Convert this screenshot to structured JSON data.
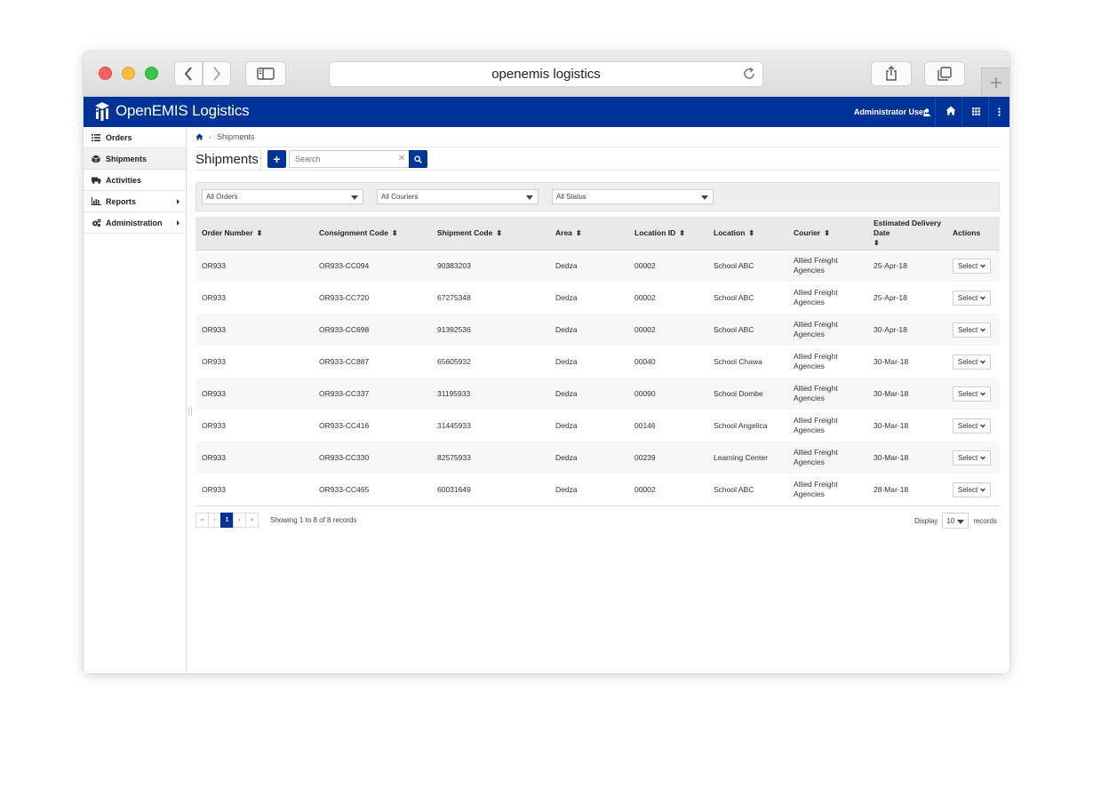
{
  "browser": {
    "url": "openemis logistics"
  },
  "app": {
    "title": "OpenEMIS Logistics",
    "user": "Administrator User",
    "accent": "#003399"
  },
  "sidebar": {
    "items": [
      {
        "label": "Orders",
        "icon": "list-icon",
        "active": false,
        "submenu": false
      },
      {
        "label": "Shipments",
        "icon": "box-icon",
        "active": true,
        "submenu": false
      },
      {
        "label": "Activities",
        "icon": "truck-icon",
        "active": false,
        "submenu": false
      },
      {
        "label": "Reports",
        "icon": "bar-chart-icon",
        "active": false,
        "submenu": true
      },
      {
        "label": "Administration",
        "icon": "cogs-icon",
        "active": false,
        "submenu": true
      }
    ]
  },
  "breadcrumb": {
    "current": "Shipments"
  },
  "page": {
    "title": "Shipments",
    "add_label": "+",
    "search_placeholder": "Search"
  },
  "filters": {
    "orders": "All Orders",
    "couriers": "All Couriers",
    "status": "All Status"
  },
  "table": {
    "headers": [
      "Order Number",
      "Consignment Code",
      "Shipment Code",
      "Area",
      "Location ID",
      "Location",
      "Courier",
      "Estimated Delivery Date",
      "Actions"
    ],
    "rows": [
      [
        "OR933",
        "OR933-CC094",
        "90383203",
        "Dedza",
        "00002",
        "School ABC",
        "Allied Freight Agencies",
        "25-Apr-18"
      ],
      [
        "OR933",
        "OR933-CC720",
        "67275348",
        "Dedza",
        "00002",
        "School ABC",
        "Allied Freight Agencies",
        "25-Apr-18"
      ],
      [
        "OR933",
        "OR933-CC698",
        "91392536",
        "Dedza",
        "00002",
        "School ABC",
        "Allied Freight Agencies",
        "30-Apr-18"
      ],
      [
        "OR933",
        "OR933-CC887",
        "65605932",
        "Dedza",
        "00040",
        "School Chawa",
        "Allied Freight Agencies",
        "30-Mar-18"
      ],
      [
        "OR933",
        "OR933-CC337",
        "31195933",
        "Dedza",
        "00090",
        "School Dombe",
        "Allied Freight Agencies",
        "30-Mar-18"
      ],
      [
        "OR933",
        "OR933-CC416",
        "31445933",
        "Dedza",
        "00146",
        "School Angelica",
        "Allied Freight Agencies",
        "30-Mar-18"
      ],
      [
        "OR933",
        "OR933-CC330",
        "82575933",
        "Dedza",
        "00239",
        "Learning Center",
        "Allied Freight Agencies",
        "30-Mar-18"
      ],
      [
        "OR933",
        "OR933-CC465",
        "60031649",
        "Dedza",
        "00002",
        "School ABC",
        "Allied Freight Agencies",
        "28-Mar-18"
      ]
    ],
    "action_label": "Select"
  },
  "pagination": {
    "first": "«",
    "prev": "‹",
    "current": "1",
    "next": "›",
    "last": "»",
    "info": "Showing 1 to 8 of 8 records",
    "display_label": "Display",
    "display_value": "10",
    "records_label": "records"
  }
}
